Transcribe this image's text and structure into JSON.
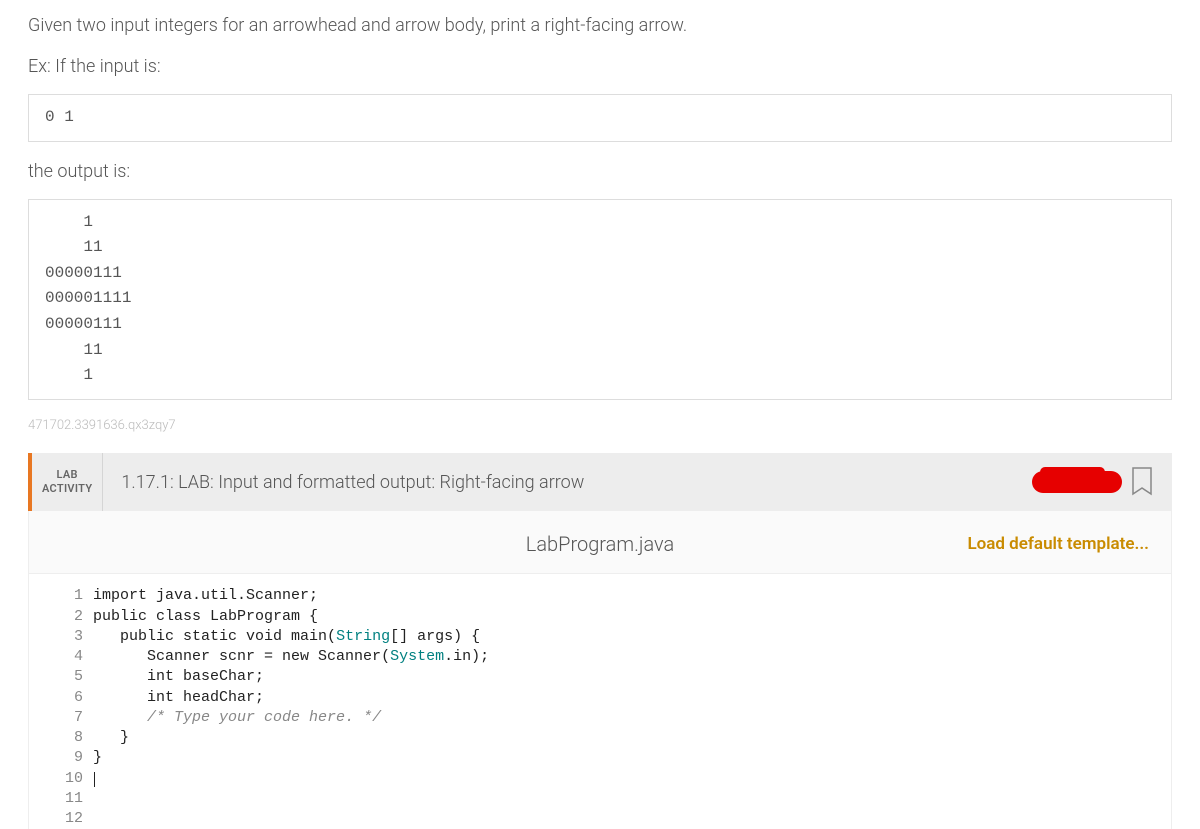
{
  "problem": {
    "sentence1": "Given two input integers for an arrowhead and arrow body, print a right-facing arrow.",
    "sentence2": "Ex: If the input is:",
    "input_example": "0 1",
    "sentence3": "the output is:",
    "output_example": "    1\n    11\n00000111\n000001111\n00000111\n    11\n    1"
  },
  "watermark": "471702.3391636.qx3zqy7",
  "lab": {
    "tag_line1": "LAB",
    "tag_line2": "ACTIVITY",
    "title": "1.17.1: LAB: Input and formatted output: Right-facing arrow"
  },
  "file": {
    "name": "LabProgram.java",
    "load_template": "Load default template..."
  },
  "code": {
    "lines": [
      "import java.util.Scanner;",
      "",
      "public class LabProgram {",
      "   public static void main(String[] args) {",
      "      Scanner scnr = new Scanner(System.in);",
      "      int baseChar;",
      "      int headChar;",
      "",
      "      /* Type your code here. */",
      "   }",
      "}",
      ""
    ],
    "line_numbers": [
      "1",
      "2",
      "3",
      "4",
      "5",
      "6",
      "7",
      "8",
      "9",
      "10",
      "11",
      "12"
    ]
  }
}
